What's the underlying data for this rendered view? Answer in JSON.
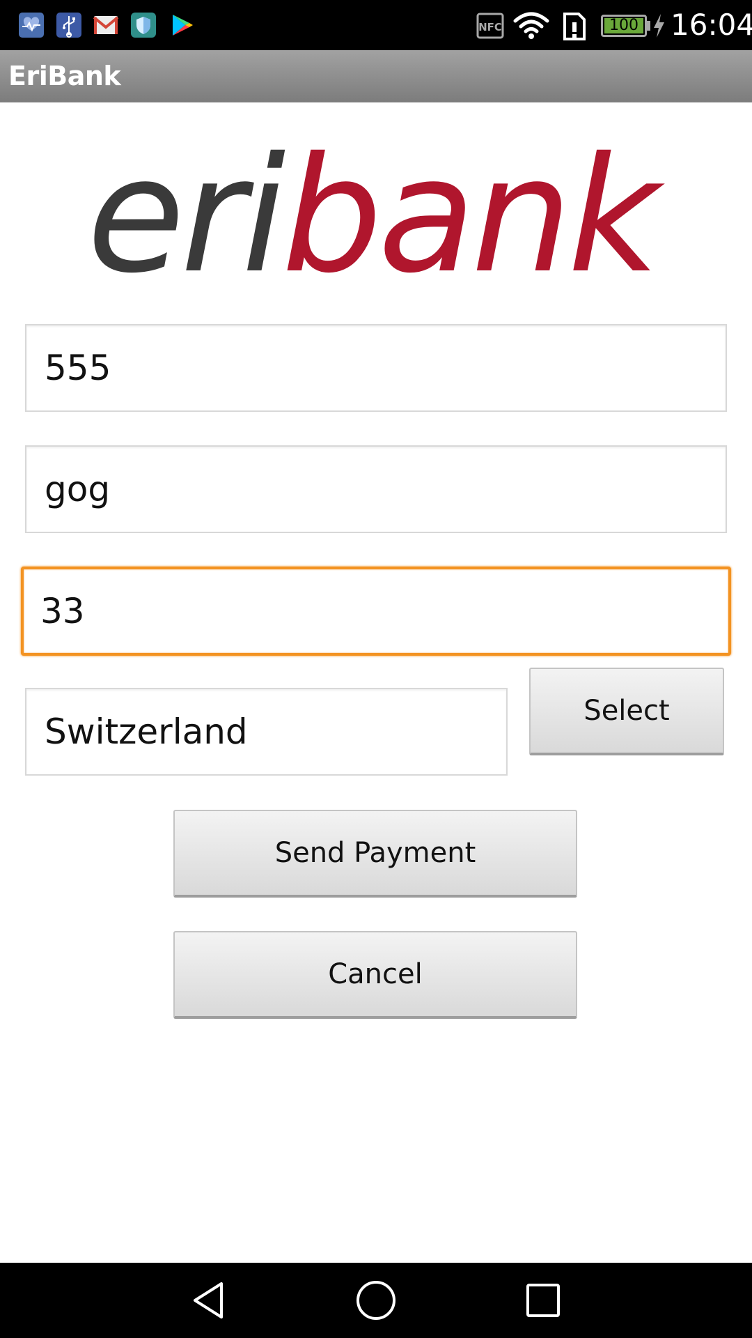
{
  "status_bar": {
    "time": "16:04",
    "battery_level": "100",
    "nfc_label": "NFC",
    "notification_icons": [
      "heart-monitor-icon",
      "usb-icon",
      "gmail-icon",
      "shield-icon",
      "play-store-icon"
    ],
    "system_icons": [
      "nfc-icon",
      "wifi-icon",
      "sim-icon",
      "battery-icon",
      "charging-icon"
    ]
  },
  "action_bar": {
    "title": "EriBank"
  },
  "logo": {
    "text_part1": "eri",
    "text_part2": "bank",
    "color_part1": "#3a3a3a",
    "color_part2": "#b0162d"
  },
  "form": {
    "phone_value": "555",
    "name_value": "gog",
    "amount_value": "33",
    "country_value": "Switzerland",
    "select_label": "Select",
    "send_payment_label": "Send Payment",
    "cancel_label": "Cancel",
    "focus_color": "#f39322"
  },
  "nav_bar": {
    "icons": [
      "back-icon",
      "home-icon",
      "recents-icon"
    ]
  }
}
